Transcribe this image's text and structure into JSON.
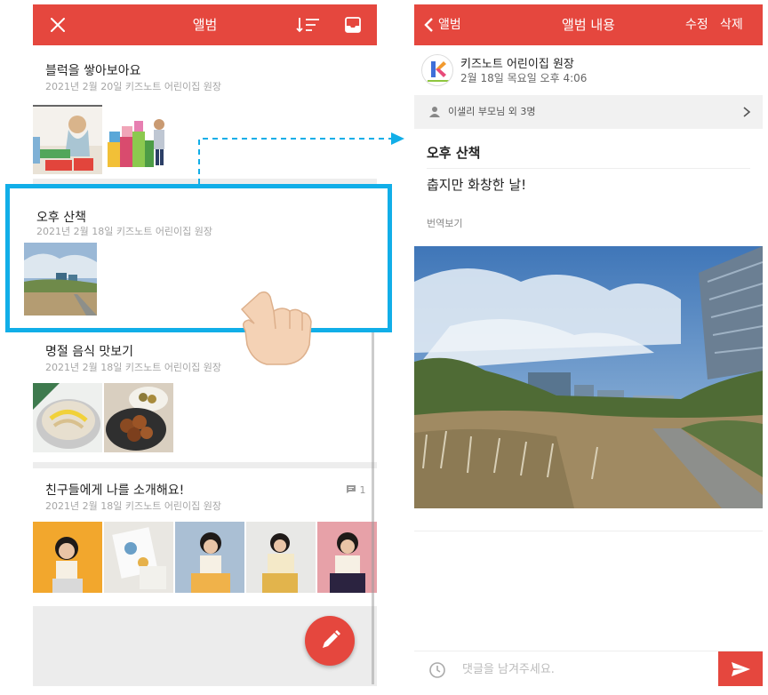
{
  "left": {
    "header": {
      "title": "앨범"
    },
    "albums": [
      {
        "title": "블럭을 쌓아보아요",
        "meta": "2021년 2월 20일 키즈노트 어린이집 원장"
      },
      {
        "title": "오후 산책",
        "meta": "2021년 2월 18일 키즈노트 어린이집 원장"
      },
      {
        "title": "명절 음식 맛보기",
        "meta": "2021년 2월 18일 키즈노트 어린이집 원장"
      },
      {
        "title": "친구들에게 나를 소개해요!",
        "meta": "2021년 2월 18일 키즈노트 어린이집 원장",
        "comment_count": "1"
      }
    ],
    "colors": {
      "accent": "#e5473e",
      "highlight": "#11aee8"
    },
    "icons": [
      "close-icon",
      "sort-icon",
      "inbox-icon",
      "comment-icon",
      "pencil-icon",
      "hand-pointer-icon"
    ]
  },
  "right": {
    "header": {
      "back_label": "앨범",
      "title": "앨범 내용",
      "edit_label": "수정",
      "delete_label": "삭제"
    },
    "author": {
      "name": "키즈노트 어린이집 원장",
      "date": "2월 18일 목요일 오후 4:06"
    },
    "recipients": "이샐리 부모님 외 3명",
    "post": {
      "title": "오후 산책",
      "body": "춥지만 화창한 날!",
      "translate_label": "번역보기"
    },
    "comment": {
      "placeholder": "댓글을 남겨주세요."
    },
    "icons": [
      "back-chevron-icon",
      "person-icon",
      "chevron-right-icon",
      "clock-icon",
      "send-icon"
    ]
  }
}
